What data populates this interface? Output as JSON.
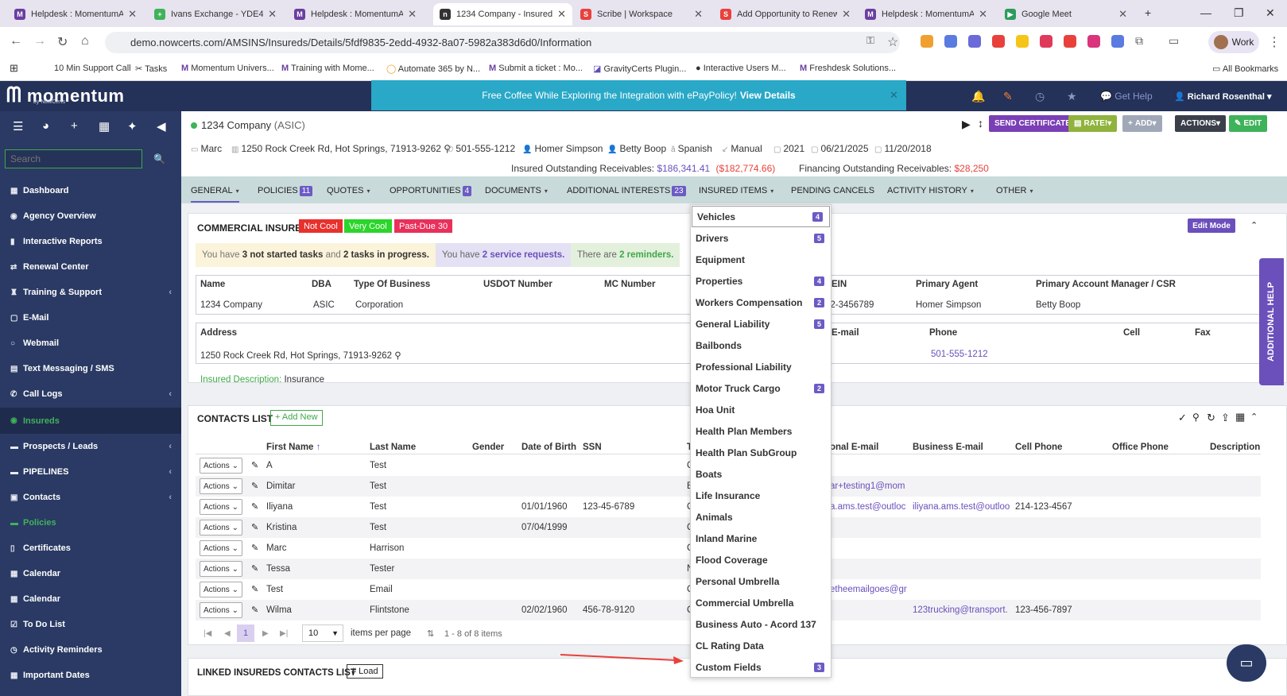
{
  "browser": {
    "tabs": [
      {
        "label": "Helpdesk : MomentumAM",
        "active": false
      },
      {
        "label": "Ivans Exchange - YDE48",
        "active": false
      },
      {
        "label": "Helpdesk : MomentumAM",
        "active": false
      },
      {
        "label": "1234 Company - Insured D",
        "active": true
      },
      {
        "label": "Scribe | Workspace",
        "active": false
      },
      {
        "label": "Add Opportunity to Renew",
        "active": false
      },
      {
        "label": "Helpdesk : MomentumAM",
        "active": false
      },
      {
        "label": "Google Meet",
        "active": false
      }
    ],
    "url": "demo.nowcerts.com/AMSINS/Insureds/Details/5fdf9835-2edd-4932-8a07-5982a383d6d0/Information",
    "profile": "Work",
    "bookmarks": [
      "10 Min Support Call",
      "Tasks",
      "Momentum Univers...",
      "Training with Mome...",
      "Automate 365 by N...",
      "Submit a ticket : Mo...",
      "GravityCerts Plugin...",
      "Interactive Users M...",
      "Freshdesk Solutions..."
    ],
    "all_bookmarks": "All Bookmarks"
  },
  "app": {
    "logo": "momentum",
    "logo_sub": "by NowCerts",
    "banner_text": "Free Coffee While Exploring the Integration with ePayPolicy!",
    "banner_link": "View Details",
    "get_help": "Get Help",
    "user": "Richard Rosenthal"
  },
  "sidebar": {
    "search_placeholder": "Search",
    "items": [
      {
        "label": "Dashboard",
        "chev": ""
      },
      {
        "label": "Agency Overview",
        "chev": ""
      },
      {
        "label": "Interactive Reports",
        "chev": ""
      },
      {
        "label": "Renewal Center",
        "chev": ""
      },
      {
        "label": "Training & Support",
        "chev": "‹"
      },
      {
        "label": "E-Mail",
        "chev": ""
      },
      {
        "label": "Webmail",
        "chev": ""
      },
      {
        "label": "Text Messaging / SMS",
        "chev": ""
      },
      {
        "label": "Call Logs",
        "chev": "‹"
      },
      {
        "label": "Insureds",
        "chev": ""
      },
      {
        "label": "Prospects / Leads",
        "chev": "‹"
      },
      {
        "label": "PIPELINES",
        "chev": "‹"
      },
      {
        "label": "Contacts",
        "chev": "‹"
      },
      {
        "label": "Policies",
        "chev": ""
      },
      {
        "label": "Certificates",
        "chev": ""
      },
      {
        "label": "Calendar",
        "chev": ""
      },
      {
        "label": "Calendar",
        "chev": ""
      },
      {
        "label": "To Do List",
        "chev": ""
      },
      {
        "label": "Activity Reminders",
        "chev": ""
      },
      {
        "label": "Important Dates",
        "chev": ""
      }
    ]
  },
  "insured": {
    "name": "1234 Company",
    "code": "(ASIC)",
    "buttons": {
      "send_certificate": "SEND CERTIFICATE",
      "rate": "RATE!",
      "add": "ADD",
      "actions": "ACTIONS",
      "edit": "EDIT"
    },
    "info": [
      "Marc",
      "1250 Rock Creek Rd, Hot Springs, 71913-9262",
      "501-555-1212",
      "Homer Simpson",
      "Betty Boop",
      "Spanish",
      "Manual",
      "2021",
      "06/21/2025",
      "11/20/2018"
    ],
    "receivables_label": "Insured Outstanding Receivables:",
    "receivables_value": "$186,341.41",
    "receivables_neg": "($182,774.66)",
    "financing_label": "Financing Outstanding Receivables:",
    "financing_value": "$28,250"
  },
  "tabs": [
    {
      "label": "GENERAL",
      "count": "",
      "chev": true
    },
    {
      "label": "POLICIES",
      "count": "11",
      "chev": false
    },
    {
      "label": "QUOTES",
      "count": "",
      "chev": true
    },
    {
      "label": "OPPORTUNITIES",
      "count": "4",
      "chev": false
    },
    {
      "label": "DOCUMENTS",
      "count": "",
      "chev": true
    },
    {
      "label": "ADDITIONAL INTERESTS",
      "count": "23",
      "chev": false
    },
    {
      "label": "INSURED ITEMS",
      "count": "",
      "chev": true
    },
    {
      "label": "PENDING CANCELS",
      "count": "",
      "chev": false
    },
    {
      "label": "ACTIVITY HISTORY",
      "count": "",
      "chev": true
    },
    {
      "label": "OTHER",
      "count": "",
      "chev": true
    }
  ],
  "commercial": {
    "title": "COMMERCIAL INSURED",
    "badges": [
      "Not Cool",
      "Very Cool",
      "Past-Due 30"
    ],
    "edit_mode": "Edit Mode",
    "tasks_notice": {
      "pre": "You have",
      "a": "3 not started tasks",
      "mid": "and",
      "b": "2 tasks in progress."
    },
    "service_notice": {
      "pre": "You have",
      "a": "2 service requests."
    },
    "reminder_notice": {
      "pre": "There are",
      "a": "2 reminders."
    },
    "headers1": [
      "Name",
      "DBA",
      "Type Of Business",
      "USDOT Number",
      "MC Number",
      "EIN",
      "Primary Agent",
      "Primary Account Manager / CSR"
    ],
    "values1": [
      "1234 Company",
      "ASIC",
      "Corporation",
      "",
      "",
      "12-3456789",
      "Homer Simpson",
      "Betty Boop"
    ],
    "headers2": [
      "Address",
      "E-mail",
      "Phone",
      "Cell",
      "Fax"
    ],
    "values2": [
      "1250 Rock Creek Rd, Hot Springs, 71913-9262",
      "",
      "501-555-1212",
      "",
      ""
    ],
    "description_label": "Insured Description:",
    "description_value": "Insurance"
  },
  "contacts": {
    "title": "CONTACTS LIST",
    "add_new": "+ Add New",
    "headers": [
      "First Name",
      "Last Name",
      "Gender",
      "Date of Birth",
      "SSN",
      "T",
      "onal E-mail",
      "Business E-mail",
      "Cell Phone",
      "Office Phone",
      "Description"
    ],
    "action_label": "Actions",
    "rows": [
      {
        "first": "A",
        "last": "Test",
        "dob": "",
        "ssn": "",
        "t": "C",
        "pemail": "",
        "bemail": "",
        "cell": ""
      },
      {
        "first": "Dimitar",
        "last": "Test",
        "dob": "",
        "ssn": "",
        "t": "B",
        "pemail": "ar+testing1@mom",
        "bemail": "",
        "cell": ""
      },
      {
        "first": "Iliyana",
        "last": "Test",
        "dob": "01/01/1960",
        "ssn": "123-45-6789",
        "t": "C",
        "pemail": "a.ams.test@outloc",
        "bemail": "iliyana.ams.test@outloo",
        "cell": "214-123-4567"
      },
      {
        "first": "Kristina",
        "last": "Test",
        "dob": "07/04/1999",
        "ssn": "",
        "t": "C",
        "pemail": "",
        "bemail": "",
        "cell": ""
      },
      {
        "first": "Marc",
        "last": "Harrison",
        "dob": "",
        "ssn": "",
        "t": "C",
        "pemail": "",
        "bemail": "",
        "cell": ""
      },
      {
        "first": "Tessa",
        "last": "Tester",
        "dob": "",
        "ssn": "",
        "t": "N",
        "pemail": "",
        "bemail": "",
        "cell": ""
      },
      {
        "first": "Test",
        "last": "Email",
        "dob": "",
        "ssn": "",
        "t": "C",
        "pemail": "etheemailgoes@gr",
        "bemail": "",
        "cell": ""
      },
      {
        "first": "Wilma",
        "last": "Flintstone",
        "dob": "02/02/1960",
        "ssn": "456-78-9120",
        "t": "C",
        "pemail": "",
        "bemail": "123trucking@transport.",
        "cell": "123-456-7897"
      }
    ],
    "page": "1",
    "page_size": "10",
    "items_per_page": "items per page",
    "range": "1 - 8 of 8 items"
  },
  "linked": {
    "title": "LINKED INSUREDS CONTACTS LIST",
    "load": "# Load"
  },
  "insured_items_menu": [
    {
      "label": "Vehicles",
      "count": "4"
    },
    {
      "label": "Drivers",
      "count": "5"
    },
    {
      "label": "Equipment",
      "count": ""
    },
    {
      "label": "Properties",
      "count": "4"
    },
    {
      "label": "Workers Compensation",
      "count": "2"
    },
    {
      "label": "General Liability",
      "count": "5"
    },
    {
      "label": "Bailbonds",
      "count": ""
    },
    {
      "label": "Professional Liability",
      "count": ""
    },
    {
      "label": "Motor Truck Cargo",
      "count": "2"
    },
    {
      "label": "Hoa Unit",
      "count": ""
    },
    {
      "label": "Health Plan Members",
      "count": ""
    },
    {
      "label": "Health Plan SubGroup",
      "count": ""
    },
    {
      "label": "Boats",
      "count": ""
    },
    {
      "label": "Life Insurance",
      "count": ""
    },
    {
      "label": "Animals",
      "count": ""
    },
    {
      "label": "Inland Marine",
      "count": ""
    },
    {
      "label": "Flood Coverage",
      "count": ""
    },
    {
      "label": "Personal Umbrella",
      "count": ""
    },
    {
      "label": "Commercial Umbrella",
      "count": ""
    },
    {
      "label": "Business Auto - Acord 137",
      "count": ""
    },
    {
      "label": "CL Rating Data",
      "count": ""
    },
    {
      "label": "Custom Fields",
      "count": "3"
    }
  ],
  "additional_help": "ADDITIONAL HELP",
  "colors": {
    "sidebar": "#2a3a64",
    "header": "#243158",
    "accent": "#6b4fbb",
    "banner": "#29a8c7",
    "green": "#3fb35a",
    "red": "#e8413c",
    "tabrow": "#c9dadb"
  }
}
